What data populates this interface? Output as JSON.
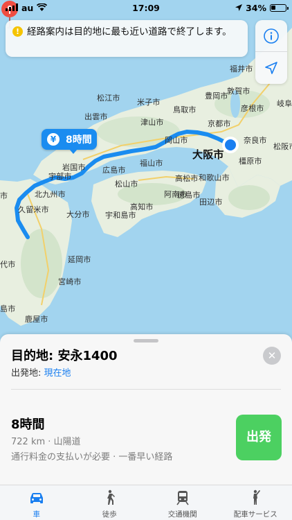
{
  "status": {
    "carrier": "au",
    "time": "17:09",
    "battery": "34%"
  },
  "banner": {
    "icon": "info-icon",
    "text": "経路案内は目的地に最も近い道路で終了します。"
  },
  "map": {
    "route_bubble": "8時間",
    "labels": {
      "matsue": "松江市",
      "yonago": "米子市",
      "izumo": "出雲市",
      "tottori": "鳥取市",
      "toyooka": "豊岡市",
      "tsuyama": "津山市",
      "fukui": "福井市",
      "tsuruga": "敦賀市",
      "hikone": "彦根市",
      "gifu": "岐阜",
      "kyoto": "京都市",
      "nara": "奈良市",
      "kashihara": "橿原市",
      "matsusaka": "松阪市",
      "osaka": "大阪市",
      "okayama": "岡山市",
      "hiroshima": "広島市",
      "fukuyama": "福山市",
      "iwakuni": "岩国市",
      "ube": "宇部市",
      "kitakyushu": "北九州市",
      "kurume": "久留米市",
      "oita": "大分市",
      "matsuyama": "松山市",
      "uwajima": "宇和島市",
      "takamatsu": "高松市",
      "tokushima": "徳島市",
      "wakayama": "和歌山市",
      "anan": "阿南市",
      "kochi": "高知市",
      "tanabe": "田辺市",
      "nobeoka": "延岡市",
      "miyazaki": "宮崎市",
      "kanoya": "鹿屋市",
      "shi_left": "市",
      "dai": "代市",
      "kagoshima": "島市"
    }
  },
  "sheet": {
    "destination": "目的地: 安永1400",
    "origin_prefix": "出発地: ",
    "origin_value": "現在地",
    "route_time": "8時間",
    "route_detail": "722 km · 山陽道",
    "route_note": "通行料金の支払いが必要 · 一番早い経路",
    "go_label": "出発",
    "close_icon": "close-icon"
  },
  "tabs": [
    {
      "label": "車",
      "icon": "car-icon",
      "active": true
    },
    {
      "label": "徒歩",
      "icon": "walking-icon",
      "active": false
    },
    {
      "label": "交通機関",
      "icon": "train-icon",
      "active": false
    },
    {
      "label": "配車サービス",
      "icon": "ride-hailing-icon",
      "active": false
    }
  ],
  "colors": {
    "accent": "#1a7ff0",
    "route": "#1a8cf0",
    "go": "#4cd061",
    "land": "#e6efe0",
    "water": "#a2d4ef",
    "pin": "#ef4e42"
  }
}
